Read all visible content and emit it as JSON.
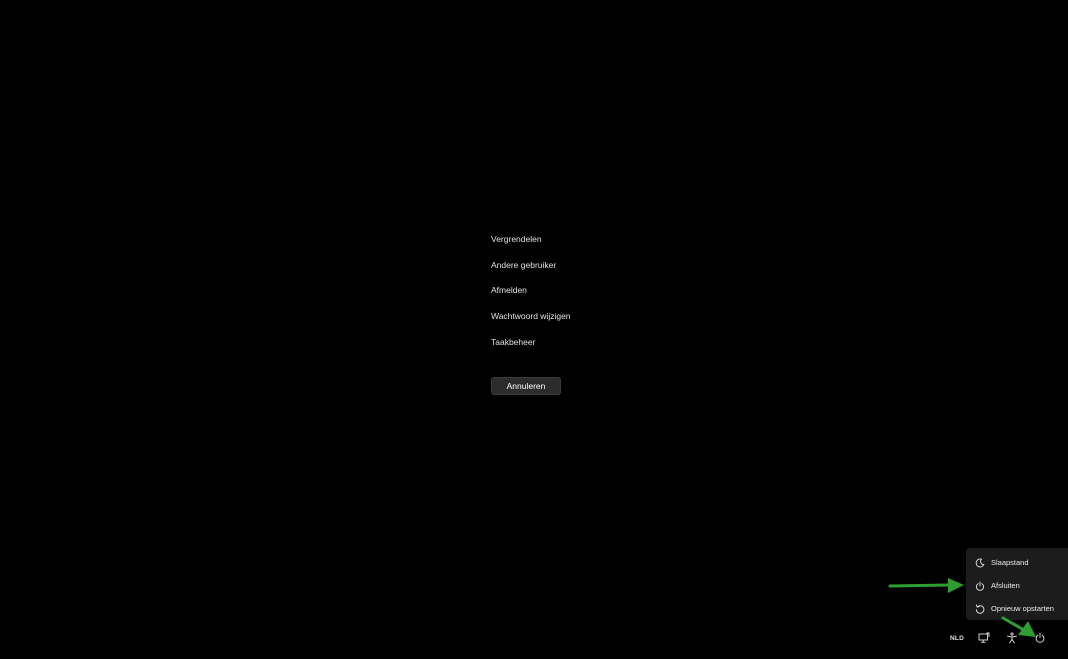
{
  "security_menu": {
    "items": [
      {
        "label": "Vergrendelen"
      },
      {
        "label": "Andere gebruiker"
      },
      {
        "label": "Afmelden"
      },
      {
        "label": "Wachtwoord wijzigen"
      },
      {
        "label": "Taakbeheer"
      }
    ],
    "cancel_label": "Annuleren"
  },
  "power_menu": {
    "items": [
      {
        "label": "Slaapstand",
        "icon": "moon-icon"
      },
      {
        "label": "Afsluiten",
        "icon": "power-icon"
      },
      {
        "label": "Opnieuw opstarten",
        "icon": "restart-icon"
      }
    ]
  },
  "tray": {
    "language": "NLD",
    "icons": [
      "display-icon",
      "accessibility-icon",
      "power-icon"
    ]
  },
  "colors": {
    "background": "#000000",
    "flyout": "#1c1c1c",
    "button": "#2c2c2c",
    "annotation_arrow": "#2e9e33"
  }
}
